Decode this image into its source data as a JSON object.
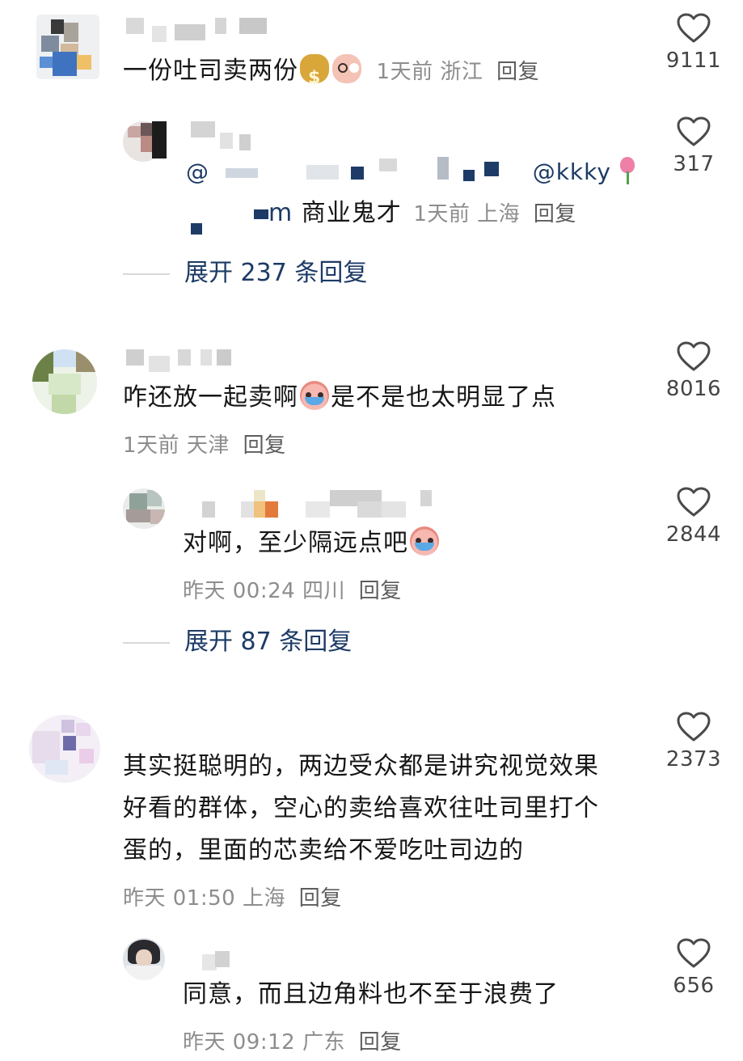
{
  "comments": [
    {
      "text": "一份吐司卖两份",
      "time": "1天前",
      "location": "浙江",
      "reply_label": "回复",
      "likes": "9111",
      "emojis": [
        "money-bag-emoji",
        "shocked-face-emoji"
      ],
      "reply": {
        "mention_prefix": "@",
        "mention_suffix": "@kkky",
        "text_prefix": "m",
        "text": "商业鬼才",
        "time": "1天前",
        "location": "上海",
        "reply_label": "回复",
        "likes": "317"
      },
      "expand_label": "展开 237 条回复"
    },
    {
      "text": "咋还放一起卖啊",
      "text_after_emoji": "是不是也太明显了点",
      "time": "1天前",
      "location": "天津",
      "reply_label": "回复",
      "likes": "8016",
      "reply": {
        "text": "对啊，至少隔远点吧",
        "time": "昨天 00:24",
        "location": "四川",
        "reply_label": "回复",
        "likes": "2844"
      },
      "expand_label": "展开 87 条回复"
    },
    {
      "text_lines": [
        "其实挺聪明的，两边受众都是讲究视觉效果",
        "好看的群体，空心的卖给喜欢往吐司里打个",
        "蛋的，里面的芯卖给不爱吃吐司边的"
      ],
      "time": "昨天 01:50",
      "location": "上海",
      "reply_label": "回复",
      "likes": "2373",
      "reply": {
        "text": "同意，而且边角料也不至于浪费了",
        "time": "昨天 09:12",
        "location": "广东",
        "reply_label": "回复",
        "likes": "656"
      }
    }
  ],
  "colors": {
    "accent": "#1d3b66",
    "meta": "#8d8d8d",
    "text": "#161616"
  }
}
